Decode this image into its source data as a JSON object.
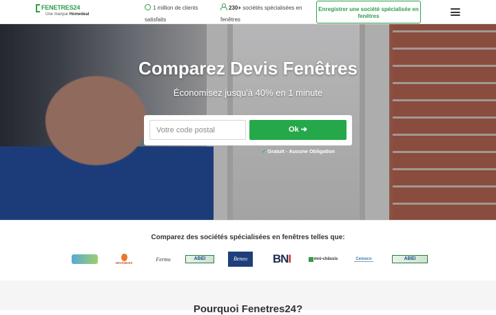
{
  "header": {
    "logo_name": "FENETRES24",
    "logo_tagline_prefix": "Une marque",
    "logo_tagline_brand": "Homedeal",
    "stat1_line1": "1 million de clients",
    "stat1_line2": "satisfaits",
    "stat2_bold": "230+",
    "stat2_line1": "sociétés spécialisées en",
    "stat2_line2": "fenêtres",
    "register_label": "Enregistrer une société spécialisée en fenêtres",
    "menu_icon": "hamburger-menu-icon"
  },
  "hero": {
    "title": "Comparez Devis Fenêtres",
    "subtitle": "Économisez jusqu'à 40% en 1 minute",
    "postal_placeholder": "Votre code postal",
    "ok_label": "Ok ➔",
    "free_note": "Gratuit - Aucune Obligation",
    "check_icon": "check-icon"
  },
  "compare": {
    "title": "Comparez des sociétés spécialisées en fenêtres telles que:",
    "brands": {
      "b3": "Fermo",
      "b4": "ABEI",
      "b5": "Beneo",
      "b6_a": "BN",
      "b6_b": "I",
      "b7": "mni-châssis",
      "b8": "Cemeco",
      "b10": "ABEI",
      "b2": "DEVISBOIS"
    }
  },
  "why": {
    "title": "Pourquoi Fenetres24?"
  },
  "colors": {
    "brand_green": "#2e9e4a",
    "ok_green": "#24a84a"
  }
}
